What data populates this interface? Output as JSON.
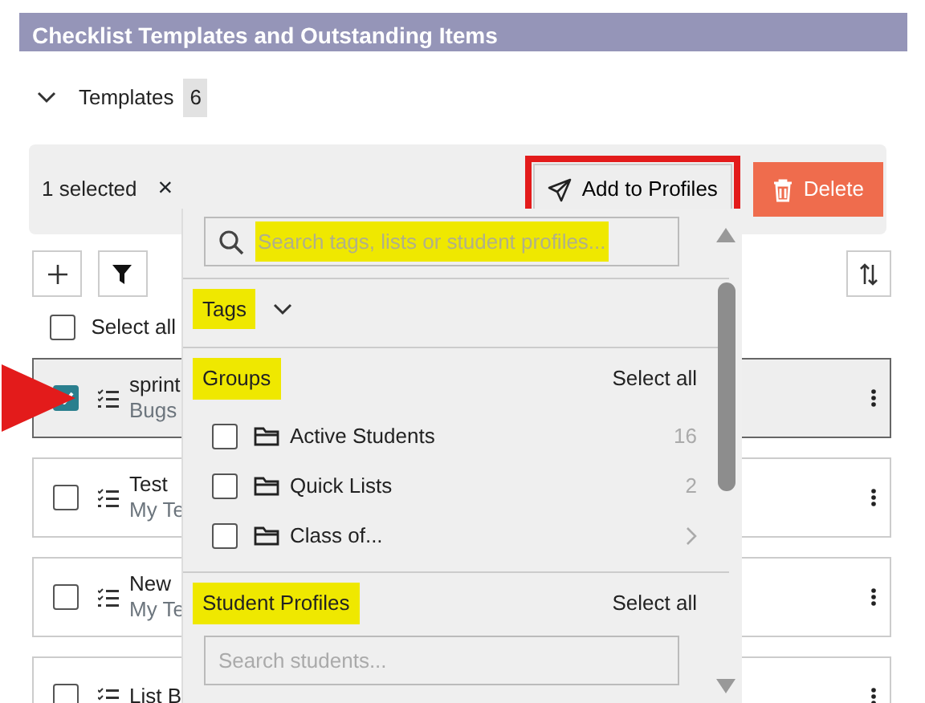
{
  "panel": {
    "title": "Checklist Templates and Outstanding Items"
  },
  "section": {
    "label": "Templates",
    "count": "6",
    "expanded": true
  },
  "selection_bar": {
    "count_text": "1 selected",
    "clear": "×",
    "buttons": [
      {
        "kind": "add",
        "label": "Add to Profiles",
        "outlined_red": true
      },
      {
        "kind": "delete",
        "label": "Delete",
        "outlined_red": false
      }
    ]
  },
  "select_all": {
    "label": "Select all",
    "checked": false
  },
  "templates": [
    {
      "title": "sprint",
      "subtitle": "Bugs",
      "checked": true,
      "selected": true,
      "arrow_marker": true
    },
    {
      "title": "Test",
      "subtitle": "My Te",
      "checked": false,
      "selected": false,
      "arrow_marker": false
    },
    {
      "title": "New",
      "subtitle": "My Te",
      "checked": false,
      "selected": false,
      "arrow_marker": false
    },
    {
      "title": "List B",
      "checked": false,
      "selected": false,
      "arrow_marker": false
    }
  ],
  "dropdown": {
    "search_placeholder": "Search tags, lists or student profiles...",
    "placeholder_highlighted": true,
    "sections": [
      {
        "kind": "collapsible",
        "title": "Tags",
        "highlighted": true,
        "expanded": false
      },
      {
        "kind": "list",
        "title": "Groups",
        "action": "Select all",
        "highlighted": true,
        "items": [
          {
            "label": "Active Students",
            "count": "16",
            "checked": false,
            "has_children": false
          },
          {
            "label": "Quick Lists",
            "count": "2",
            "checked": false,
            "has_children": false
          },
          {
            "label": "Class of...",
            "checked": false,
            "has_children": true
          }
        ]
      },
      {
        "kind": "search",
        "title": "Student Profiles",
        "action": "Select all",
        "placeholder": "Search students...",
        "highlighted": true
      }
    ]
  }
}
